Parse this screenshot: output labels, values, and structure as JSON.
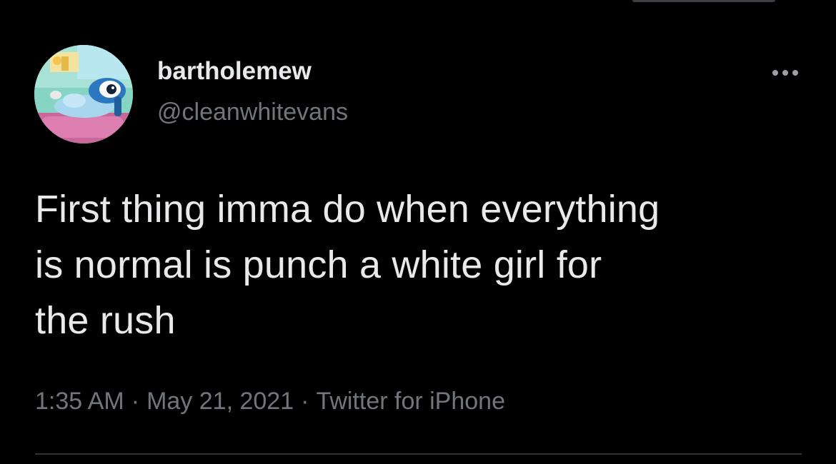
{
  "tweet": {
    "author": {
      "display_name": "bartholemew",
      "handle": "@cleanwhitevans",
      "avatar_icon": "cartoon-character-avatar"
    },
    "more_icon": "more-horizontal-icon",
    "text": "First thing imma do when everything\nis normal is punch a white girl for\nthe rush",
    "meta": {
      "time": "1:35 AM",
      "separator": "·",
      "date": "May 21, 2021",
      "source": "Twitter for iPhone"
    }
  },
  "colors": {
    "background": "#000000",
    "primary_text": "#e7e9ea",
    "secondary_text": "#71767b",
    "divider": "#2f3336"
  }
}
